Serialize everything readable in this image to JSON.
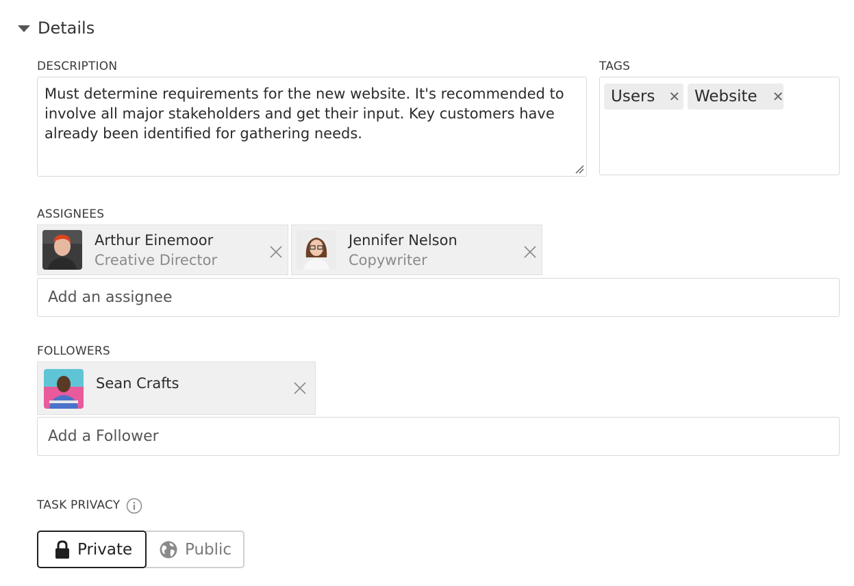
{
  "section": {
    "title": "Details",
    "expanded": true
  },
  "description": {
    "label": "DESCRIPTION",
    "value": "Must determine requirements for the new website. It's recommended to involve all major stakeholders and get their input. Key customers have already been identified for gathering needs."
  },
  "tags": {
    "label": "TAGS",
    "items": [
      {
        "label": "Users",
        "remove_icon": "close-icon"
      },
      {
        "label": "Website",
        "remove_icon": "close-icon"
      }
    ]
  },
  "assignees": {
    "label": "ASSIGNEES",
    "items": [
      {
        "name": "Arthur Einemoor",
        "role": "Creative Director",
        "avatar": "avatar-photo"
      },
      {
        "name": "Jennifer Nelson",
        "role": "Copywriter",
        "avatar": "avatar-photo"
      }
    ],
    "add_placeholder": "Add an assignee"
  },
  "followers": {
    "label": "FOLLOWERS",
    "items": [
      {
        "name": "Sean Crafts",
        "avatar": "avatar-photo"
      }
    ],
    "add_placeholder": "Add a Follower"
  },
  "privacy": {
    "label": "TASK PRIVACY",
    "info_icon": "info-icon",
    "options": [
      {
        "label": "Private",
        "icon": "lock-icon",
        "selected": true
      },
      {
        "label": "Public",
        "icon": "globe-icon",
        "selected": false
      }
    ]
  },
  "colors": {
    "border": "#d8d8d8",
    "chip_bg": "#f0f0f0",
    "tag_bg": "#ececec",
    "selected_border": "#1f1f1f",
    "muted_text": "#8a8a8a"
  }
}
